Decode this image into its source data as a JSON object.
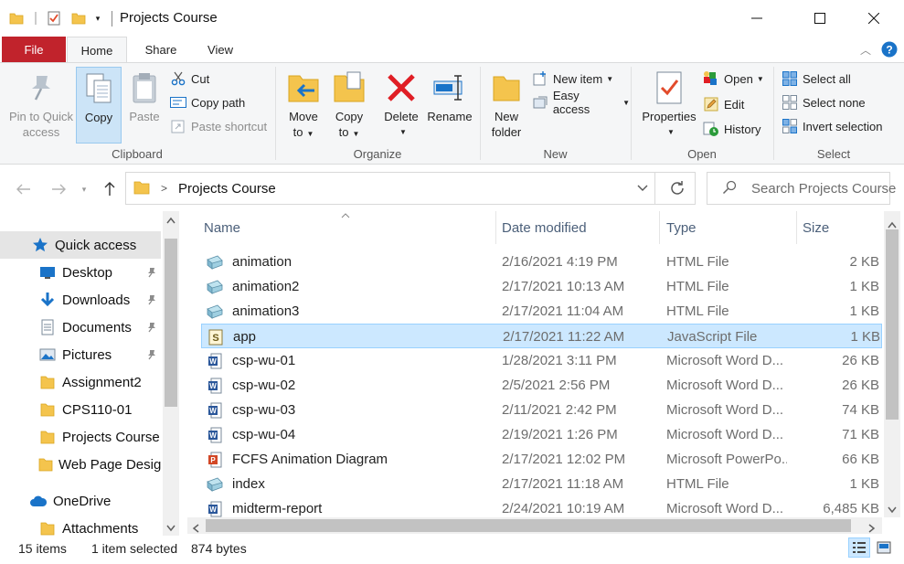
{
  "window": {
    "title": "Projects Course",
    "minimize_icon": "minimize-icon",
    "maximize_icon": "maximize-icon",
    "close_icon": "close-icon"
  },
  "ribbon_tabs": {
    "file": "File",
    "home": "Home",
    "share": "Share",
    "view": "View"
  },
  "clipboard": {
    "group_label": "Clipboard",
    "pin_line1": "Pin to Quick",
    "pin_line2": "access",
    "copy": "Copy",
    "paste": "Paste",
    "cut": "Cut",
    "copy_path": "Copy path",
    "paste_shortcut": "Paste shortcut"
  },
  "organize": {
    "group_label": "Organize",
    "move_to_line1": "Move",
    "move_to_line2": "to",
    "copy_to_line1": "Copy",
    "copy_to_line2": "to",
    "delete": "Delete",
    "rename": "Rename"
  },
  "new_group": {
    "group_label": "New",
    "new_folder_line1": "New",
    "new_folder_line2": "folder",
    "new_item": "New item",
    "easy_access": "Easy access"
  },
  "open_group": {
    "group_label": "Open",
    "properties": "Properties",
    "open": "Open",
    "edit": "Edit",
    "history": "History"
  },
  "select_group": {
    "group_label": "Select",
    "select_all": "Select all",
    "select_none": "Select none",
    "invert_selection": "Invert selection"
  },
  "address_bar": {
    "path": "Projects Course",
    "search_placeholder": "Search Projects Course"
  },
  "nav_pane": {
    "quick_access": "Quick access",
    "items": [
      {
        "label": "Desktop",
        "pinned": true
      },
      {
        "label": "Downloads",
        "pinned": true
      },
      {
        "label": "Documents",
        "pinned": true
      },
      {
        "label": "Pictures",
        "pinned": true
      },
      {
        "label": "Assignment2",
        "pinned": false
      },
      {
        "label": "CPS110-01",
        "pinned": false
      },
      {
        "label": "Projects Course",
        "pinned": false
      },
      {
        "label": "Web Page Desig",
        "pinned": false
      }
    ],
    "onedrive": "OneDrive",
    "attachments": "Attachments"
  },
  "columns": {
    "name": "Name",
    "date_modified": "Date modified",
    "type": "Type",
    "size": "Size"
  },
  "files": [
    {
      "name": "animation",
      "date": "2/16/2021 4:19 PM",
      "type": "HTML File",
      "size": "2 KB",
      "icon": "html-file-icon"
    },
    {
      "name": "animation2",
      "date": "2/17/2021 10:13 AM",
      "type": "HTML File",
      "size": "1 KB",
      "icon": "html-file-icon"
    },
    {
      "name": "animation3",
      "date": "2/17/2021 11:04 AM",
      "type": "HTML File",
      "size": "1 KB",
      "icon": "html-file-icon"
    },
    {
      "name": "app",
      "date": "2/17/2021 11:22 AM",
      "type": "JavaScript File",
      "size": "1 KB",
      "icon": "js-file-icon",
      "selected": true
    },
    {
      "name": "csp-wu-01",
      "date": "1/28/2021 3:11 PM",
      "type": "Microsoft Word D...",
      "size": "26 KB",
      "icon": "word-file-icon"
    },
    {
      "name": "csp-wu-02",
      "date": "2/5/2021 2:56 PM",
      "type": "Microsoft Word D...",
      "size": "26 KB",
      "icon": "word-file-icon"
    },
    {
      "name": "csp-wu-03",
      "date": "2/11/2021 2:42 PM",
      "type": "Microsoft Word D...",
      "size": "74 KB",
      "icon": "word-file-icon"
    },
    {
      "name": "csp-wu-04",
      "date": "2/19/2021 1:26 PM",
      "type": "Microsoft Word D...",
      "size": "71 KB",
      "icon": "word-file-icon"
    },
    {
      "name": "FCFS Animation Diagram",
      "date": "2/17/2021 12:02 PM",
      "type": "Microsoft PowerPo...",
      "size": "66 KB",
      "icon": "powerpoint-file-icon"
    },
    {
      "name": "index",
      "date": "2/17/2021 11:18 AM",
      "type": "HTML File",
      "size": "1 KB",
      "icon": "html-file-icon"
    },
    {
      "name": "midterm-report",
      "date": "2/24/2021 10:19 AM",
      "type": "Microsoft Word D...",
      "size": "6,485 KB",
      "icon": "word-file-icon"
    }
  ],
  "status_bar": {
    "item_count": "15 items",
    "selection": "1 item selected",
    "selection_size": "874 bytes"
  },
  "colors": {
    "file_tab": "#c1232c",
    "selection_bg": "#cce8ff",
    "column_header_text": "#4c607a",
    "folder_yellow": "#f4c44d",
    "accent_blue": "#1a73c8"
  }
}
